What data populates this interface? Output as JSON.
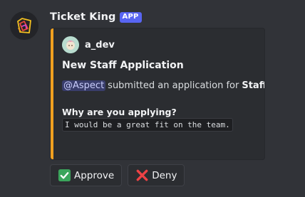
{
  "bot": {
    "name": "Ticket King",
    "badge": "APP",
    "avatar_icon": "crown-logo-icon"
  },
  "embed": {
    "accent_color": "#f0a020",
    "author": {
      "name": "a_dev",
      "avatar_icon": "user-avatar-icon"
    },
    "title": "New Staff Application",
    "description": {
      "mention": "@Aspect",
      "text": "submitted an application for",
      "role": "Staff",
      "suffix": "."
    },
    "fields": [
      {
        "name": "Why are you applying?",
        "value": "I would be a great fit on the team."
      }
    ]
  },
  "buttons": [
    {
      "label": "Approve",
      "icon": "check-mark-icon",
      "icon_color": "#3ba55c"
    },
    {
      "label": "Deny",
      "icon": "cross-mark-icon",
      "icon_color": "#ed4245"
    }
  ]
}
